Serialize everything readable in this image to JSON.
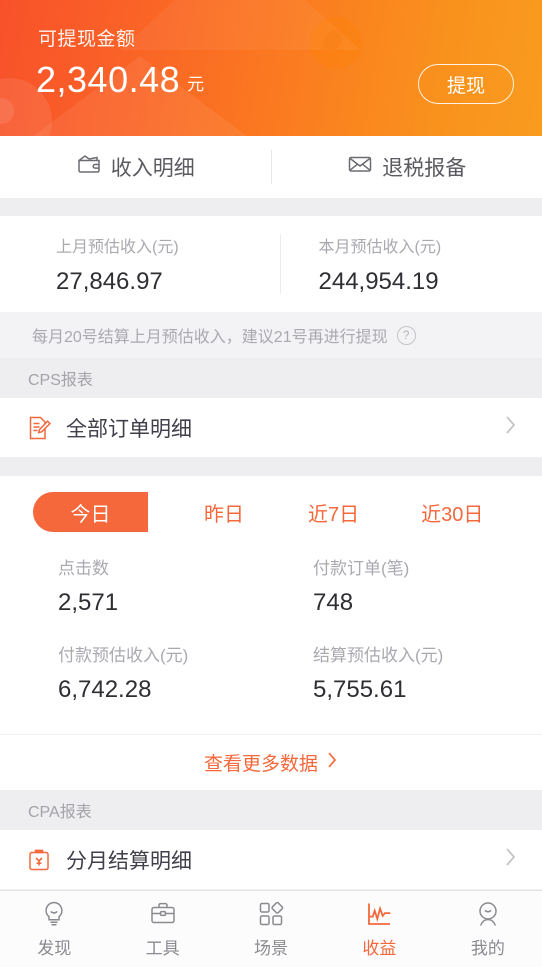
{
  "header": {
    "balance_label": "可提现金额",
    "balance_amount": "2,340.48",
    "balance_unit": "元",
    "withdraw_button": "提现",
    "gradient_start": "#F8512A",
    "gradient_end": "#F99C1E"
  },
  "top_tabs": [
    {
      "label": "收入明细",
      "icon": "wallet-icon"
    },
    {
      "label": "退税报备",
      "icon": "envelope-icon"
    }
  ],
  "estimates": [
    {
      "label": "上月预估收入(元)",
      "value": "27,846.97"
    },
    {
      "label": "本月预估收入(元)",
      "value": "244,954.19"
    }
  ],
  "note": {
    "text": "每月20号结算上月预估收入，建议21号再进行提现",
    "help_icon": "question-mark-icon"
  },
  "cps": {
    "section_title": "CPS报表",
    "row_label": "全部订单明细",
    "row_icon": "document-edit-icon",
    "chevron": "›"
  },
  "periods": [
    {
      "label": "今日",
      "active": true
    },
    {
      "label": "昨日",
      "active": false
    },
    {
      "label": "近7日",
      "active": false
    },
    {
      "label": "近30日",
      "active": false
    }
  ],
  "stats": [
    {
      "label": "点击数",
      "value": "2,571"
    },
    {
      "label": "付款订单(笔)",
      "value": "748"
    },
    {
      "label": "付款预估收入(元)",
      "value": "6,742.28"
    },
    {
      "label": "结算预估收入(元)",
      "value": "5,755.61"
    }
  ],
  "more_link": {
    "label": "查看更多数据",
    "chevron": "›"
  },
  "cpa": {
    "section_title": "CPA报表",
    "row_label": "分月结算明细",
    "row_icon": "clipboard-yuan-icon",
    "chevron": "›"
  },
  "bottom_nav": [
    {
      "label": "发现",
      "icon": "lightbulb-icon",
      "active": false
    },
    {
      "label": "工具",
      "icon": "briefcase-icon",
      "active": false
    },
    {
      "label": "场景",
      "icon": "grid-shapes-icon",
      "active": false
    },
    {
      "label": "收益",
      "icon": "line-chart-icon",
      "active": true
    },
    {
      "label": "我的",
      "icon": "person-icon",
      "active": false
    }
  ],
  "accent_color": "#F4683C",
  "muted_color": "#A9A9B0"
}
